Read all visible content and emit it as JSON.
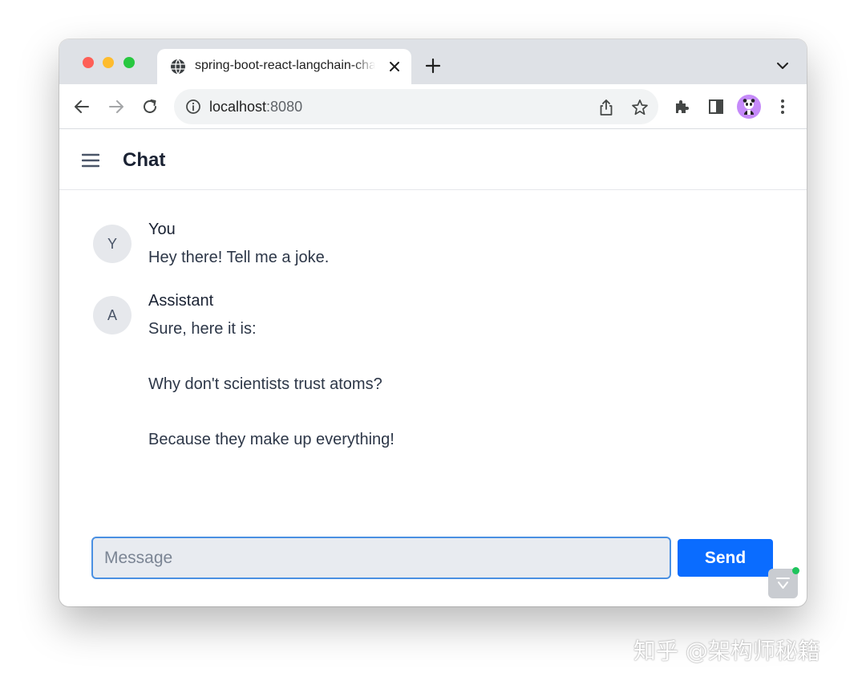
{
  "browser": {
    "tab_title": "spring-boot-react-langchain-chat",
    "url_host": "localhost",
    "url_port": ":8080",
    "colors": {
      "tabstrip": "#dee1e6",
      "avatar_chip": "#c58af9"
    }
  },
  "app": {
    "title": "Chat",
    "messages": [
      {
        "avatar": "Y",
        "sender": "You",
        "lines": [
          "Hey there! Tell me a joke."
        ]
      },
      {
        "avatar": "A",
        "sender": "Assistant",
        "lines": [
          "Sure, here it is:",
          "",
          "Why don't scientists trust atoms?",
          "",
          "Because they make up everything!"
        ]
      }
    ],
    "composer": {
      "placeholder": "Message",
      "send_label": "Send"
    },
    "colors": {
      "send": "#0a6cff",
      "input_border": "#4a90e2"
    }
  },
  "watermark": "知乎 @架构师秘籍",
  "icons": [
    "globe-icon",
    "close-icon",
    "plus-icon",
    "chevron-down-icon",
    "back-arrow-icon",
    "forward-arrow-icon",
    "reload-icon",
    "info-icon",
    "share-icon",
    "star-icon",
    "puzzle-icon",
    "side-panel-icon",
    "kebab-menu-icon",
    "hamburger-icon"
  ]
}
